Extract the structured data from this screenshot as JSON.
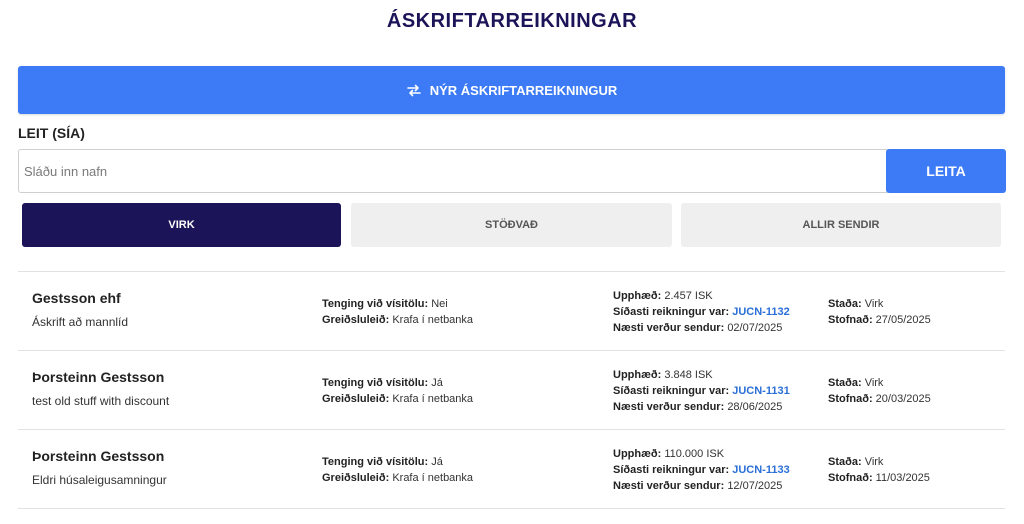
{
  "page": {
    "title": "ÁSKRIFTARREIKNINGAR"
  },
  "new_button": {
    "label": "NÝR ÁSKRIFTARREIKNINGUR"
  },
  "search": {
    "label": "LEIT (SÍA)",
    "placeholder": "Sláðu inn nafn",
    "value": "",
    "button_label": "LEITA"
  },
  "tabs": [
    {
      "label": "VIRK",
      "active": true
    },
    {
      "label": "STÖÐVAÐ",
      "active": false
    },
    {
      "label": "ALLIR SENDIR",
      "active": false
    }
  ],
  "labels": {
    "index_link": "Tenging við vísitölu:",
    "payment_method": "Greiðsluleið:",
    "amount": "Upphæð:",
    "last_invoice": "Síðasti reikningur var:",
    "next_send": "Næsti verður sendur:",
    "status": "Staða:",
    "created": "Stofnað:"
  },
  "subscriptions": [
    {
      "name": "Gestsson ehf",
      "description": "Áskrift að mannlíd",
      "index_link": "Nei",
      "payment_method": "Krafa í netbanka",
      "amount": "2.457 ISK",
      "last_invoice": "JUCN-1132",
      "next_send": "02/07/2025",
      "status": "Virk",
      "created": "27/05/2025"
    },
    {
      "name": "Þorsteinn Gestsson",
      "description": "test old stuff with discount",
      "index_link": "Já",
      "payment_method": "Krafa í netbanka",
      "amount": "3.848 ISK",
      "last_invoice": "JUCN-1131",
      "next_send": "28/06/2025",
      "status": "Virk",
      "created": "20/03/2025"
    },
    {
      "name": "Þorsteinn Gestsson",
      "description": "Eldri húsaleigusamningur",
      "index_link": "Já",
      "payment_method": "Krafa í netbanka",
      "amount": "110.000 ISK",
      "last_invoice": "JUCN-1133",
      "next_send": "12/07/2025",
      "status": "Virk",
      "created": "11/03/2025"
    }
  ],
  "icons": {
    "new_button_icon": "repeat-arrows-icon"
  },
  "colors": {
    "accent": "#3d7bf6",
    "navy": "#1c1458",
    "link": "#2a6fd6",
    "inactive_tab": "#efefef"
  }
}
